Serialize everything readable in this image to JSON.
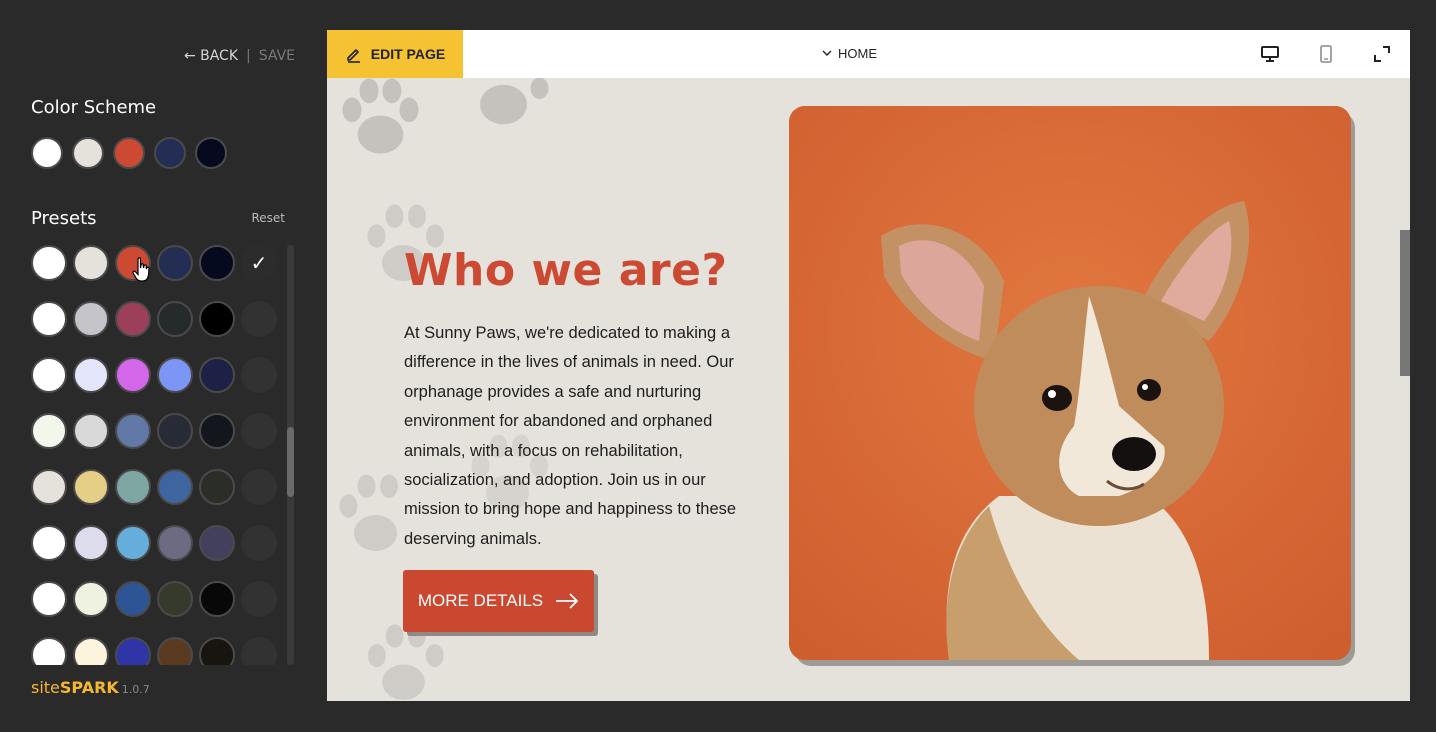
{
  "sidebar": {
    "back_label": "← BACK",
    "separator": "|",
    "save_label": "SAVE",
    "color_scheme_title": "Color Scheme",
    "color_scheme": [
      "#ffffff",
      "#e5e1db",
      "#cc4a33",
      "#242e54",
      "#050a1f"
    ],
    "presets_title": "Presets",
    "reset_label": "Reset",
    "presets": [
      [
        "#ffffff",
        "#e5e1db",
        "#cc4a33",
        "#242e54",
        "#050a1f"
      ],
      [
        "#ffffff",
        "#c6c4cb",
        "#9c4059",
        "#252b2b",
        "#000000"
      ],
      [
        "#ffffff",
        "#e3e6fa",
        "#d466ea",
        "#7b96f5",
        "#1c2145"
      ],
      [
        "#f2f7ec",
        "#d9d9d9",
        "#6279a8",
        "#262b36",
        "#13171d"
      ],
      [
        "#e5e1db",
        "#e5ce86",
        "#7ea7a3",
        "#3f65a0",
        "#2b2d29"
      ],
      [
        "#ffffff",
        "#dcdcec",
        "#65aedb",
        "#6d6b82",
        "#43405e"
      ],
      [
        "#ffffff",
        "#eff2e0",
        "#2d5596",
        "#353a2c",
        "#080808"
      ],
      [
        "#ffffff",
        "#fdf4de",
        "#2f34a6",
        "#5b3a22",
        "#181410"
      ]
    ],
    "selected_check": "✓",
    "brand_light": "site",
    "brand_bold": "SPARK",
    "version": "1.0.7"
  },
  "preview": {
    "edit_label": "EDIT PAGE",
    "page_selector": "HOME",
    "hero_title": "Who we are?",
    "hero_text": "At Sunny Paws, we're dedicated to making a difference in the lives of animals in need. Our orphanage provides a safe and nurturing environment for abandoned and orphaned animals, with a focus on rehabilitation, socialization, and adoption. Join us in our mission to bring hope and happiness to these deserving animals.",
    "cta_label": "MORE DETAILS"
  },
  "icons": {
    "edit": "pencil-icon",
    "page_selector": "chevron-down-icon",
    "desktop": "desktop-icon",
    "mobile": "mobile-icon",
    "fullscreen": "fullscreen-icon",
    "cta": "arrow-right-icon",
    "check": "check-icon"
  },
  "colors": {
    "accent": "#cc4a33",
    "edit_bar": "#f5c233",
    "brand": "#f5b731",
    "hero_background": "#e5e1db"
  }
}
